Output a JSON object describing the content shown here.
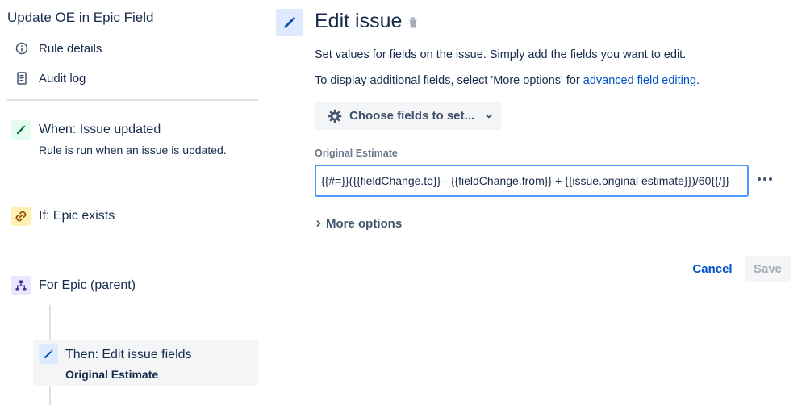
{
  "rule": {
    "title": "Update OE in Epic Field"
  },
  "nav": {
    "rule_details": "Rule details",
    "audit_log": "Audit log"
  },
  "components": {
    "trigger": {
      "title": "When: Issue updated",
      "subtitle": "Rule is run when an issue is updated.",
      "icon": "pencil-icon",
      "color": "#e3fcef"
    },
    "condition": {
      "title": "If: Epic exists",
      "icon": "link-icon",
      "color": "#fff0b3"
    },
    "branch": {
      "title": "For Epic (parent)",
      "icon": "hierarchy-icon",
      "color": "#eae6ff"
    },
    "action": {
      "title": "Then: Edit issue fields",
      "subtitle": "Original Estimate",
      "icon": "pencil-icon",
      "color": "#deebff"
    }
  },
  "panel": {
    "title": "Edit issue",
    "description": "Set values for fields on the issue. Simply add the fields you want to edit.",
    "more_text": "To display additional fields, select 'More options' for ",
    "more_link": "advanced field editing",
    "more_suffix": ".",
    "choose_fields": "Choose fields to set...",
    "field_label": "Original Estimate",
    "field_value": "{{#=}}({{fieldChange.to}} - {{fieldChange.from}} + {{issue.original estimate}})/60{{/}}",
    "more_options": "More options",
    "cancel": "Cancel",
    "save": "Save"
  },
  "colors": {
    "link": "#0052cc",
    "text": "#172b4d",
    "muted": "#6b778c",
    "focus_border": "#4c9aff"
  }
}
